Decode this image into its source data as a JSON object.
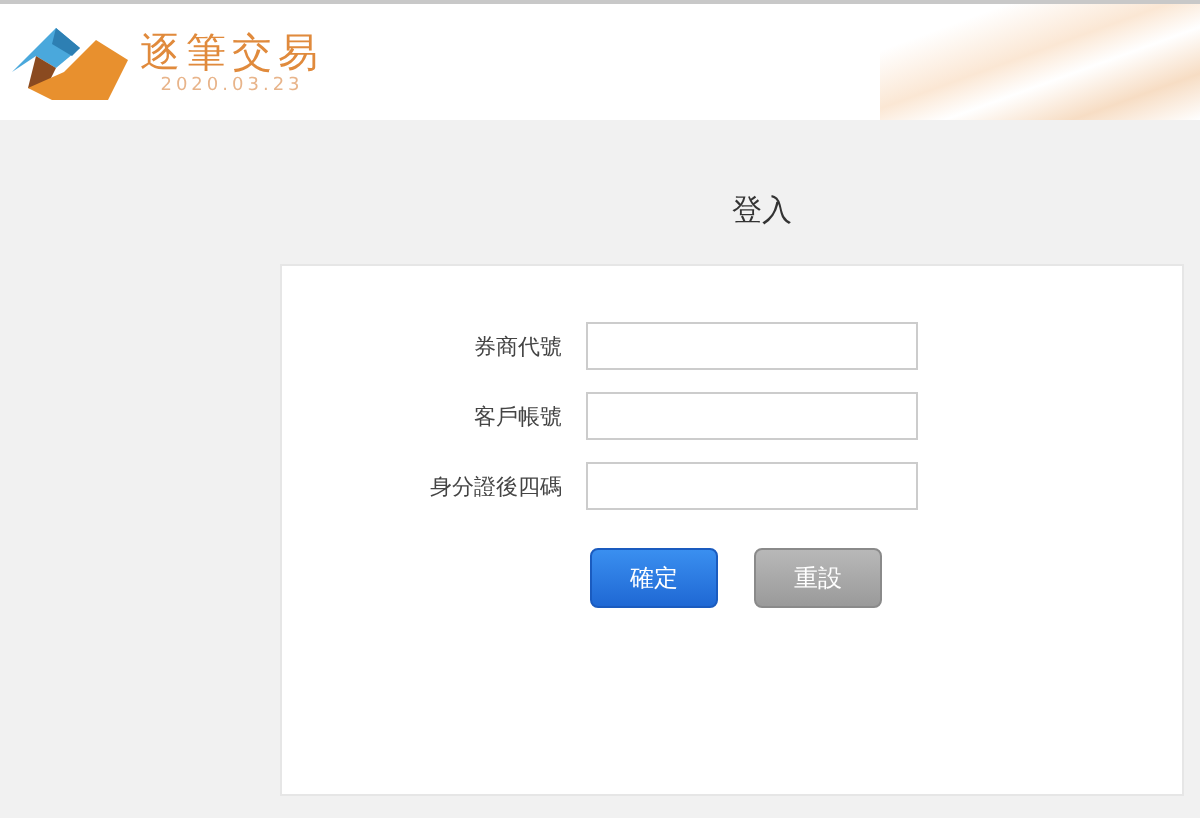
{
  "header": {
    "logo_text": "逐筆交易",
    "logo_date": "2020.03.23"
  },
  "title": "登入",
  "form": {
    "fields": [
      {
        "label": "券商代號"
      },
      {
        "label": "客戶帳號"
      },
      {
        "label": "身分證後四碼"
      }
    ],
    "buttons": [
      {
        "label": "確定",
        "kind": "primary"
      },
      {
        "label": "重設",
        "kind": "secondary"
      }
    ]
  }
}
